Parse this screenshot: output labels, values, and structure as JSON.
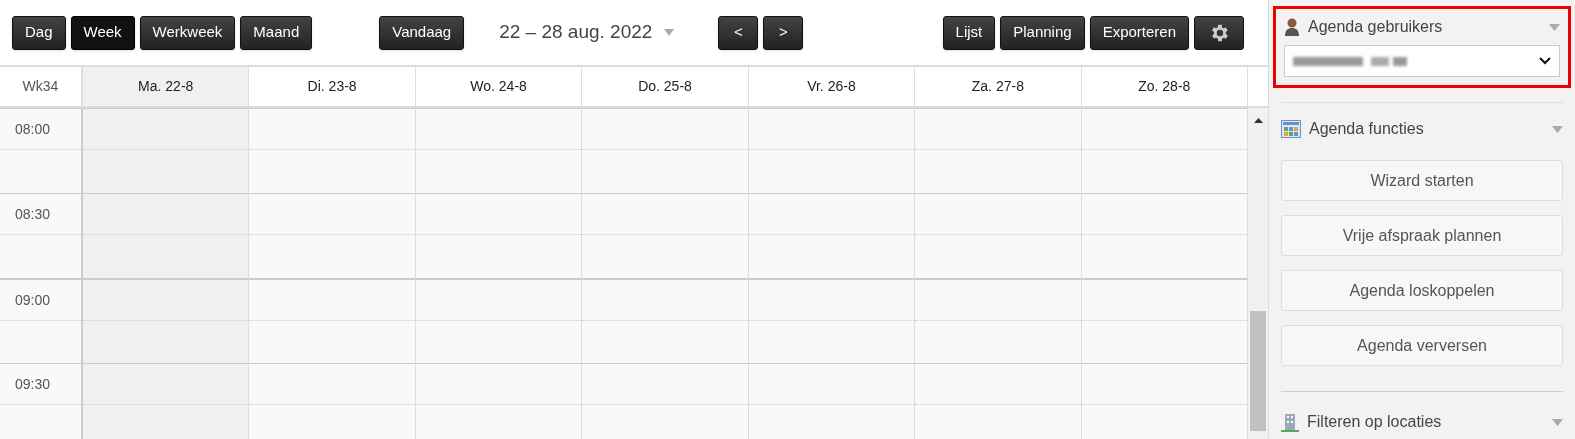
{
  "toolbar": {
    "views": [
      {
        "label": "Dag",
        "selected": false
      },
      {
        "label": "Week",
        "selected": true
      },
      {
        "label": "Werkweek",
        "selected": false
      },
      {
        "label": "Maand",
        "selected": false
      }
    ],
    "today": "Vandaag",
    "range": "22 – 28 aug. 2022",
    "prev": "<",
    "next": ">",
    "actions": [
      "Lijst",
      "Planning",
      "Exporteren"
    ]
  },
  "calendar": {
    "week": "Wk34",
    "days": [
      {
        "label": "Ma. 22-8",
        "selected": true
      },
      {
        "label": "Di. 23-8",
        "selected": false
      },
      {
        "label": "Wo. 24-8",
        "selected": false
      },
      {
        "label": "Do. 25-8",
        "selected": false
      },
      {
        "label": "Vr. 26-8",
        "selected": false
      },
      {
        "label": "Za. 27-8",
        "selected": false
      },
      {
        "label": "Zo. 28-8",
        "selected": false
      }
    ],
    "times": [
      "08:00",
      "08:30",
      "09:00",
      "09:30"
    ]
  },
  "sidebar": {
    "users": {
      "title": "Agenda gebruikers",
      "highlighted": true
    },
    "functions": {
      "title": "Agenda functies",
      "buttons": [
        "Wizard starten",
        "Vrije afspraak plannen",
        "Agenda loskoppelen",
        "Agenda verversen"
      ]
    },
    "locations": {
      "title": "Filteren op locaties"
    }
  }
}
